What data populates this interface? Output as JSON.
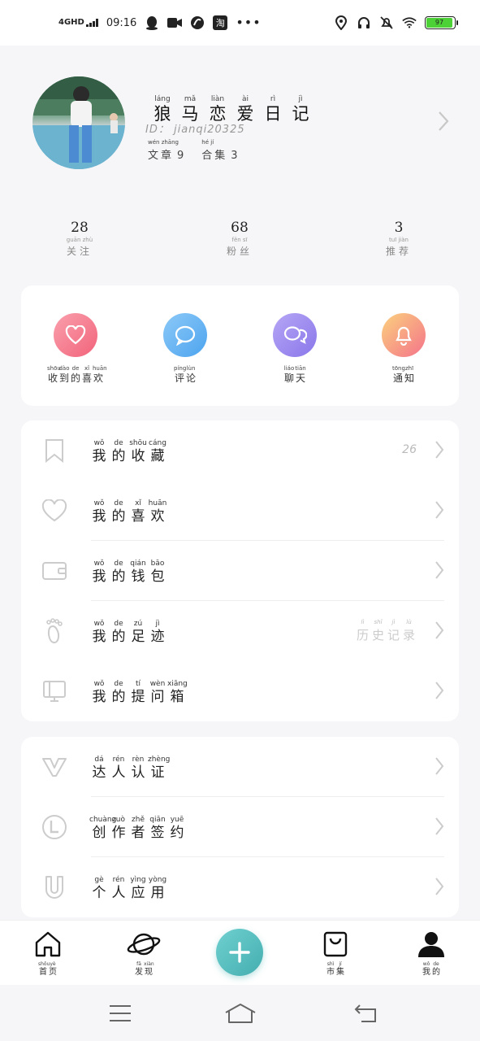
{
  "status_bar": {
    "network": "4GHD",
    "time": "09:16",
    "tao_icon_text": "淘",
    "more": "•••",
    "battery_level": "97"
  },
  "profile": {
    "name": [
      {
        "py": "láng",
        "hz": "狼"
      },
      {
        "py": "mǎ",
        "hz": "马"
      },
      {
        "py": "liàn",
        "hz": "恋"
      },
      {
        "py": "ài",
        "hz": "爱"
      },
      {
        "py": "rì",
        "hz": "日"
      },
      {
        "py": "jì",
        "hz": "记"
      }
    ],
    "id": "ID： jianqi20325",
    "articles": {
      "py": "wén zhāng",
      "hz": "文章",
      "count": "9"
    },
    "collections": {
      "py": "hé jí",
      "hz": "合集",
      "count": "3"
    }
  },
  "stats": [
    {
      "value": "28",
      "py": "guān zhù",
      "hz": "关注"
    },
    {
      "value": "68",
      "py": "fěn sī",
      "hz": "粉丝"
    },
    {
      "value": "3",
      "py": "tuī jiàn",
      "hz": "推荐"
    }
  ],
  "actions": [
    {
      "icon": "heart-icon",
      "color1": "#f9a0ad",
      "color2": "#f2637a",
      "label": [
        {
          "py": "shōu",
          "hz": "收"
        },
        {
          "py": "dào",
          "hz": "到"
        },
        {
          "py": "de",
          "hz": "的"
        },
        {
          "py": "xǐ",
          "hz": "喜"
        },
        {
          "py": "huān",
          "hz": "欢"
        }
      ]
    },
    {
      "icon": "comment-icon",
      "color1": "#8cc9f8",
      "color2": "#4da4ef",
      "label": [
        {
          "py": "píng",
          "hz": "评"
        },
        {
          "py": "lùn",
          "hz": "论"
        }
      ]
    },
    {
      "icon": "chat-icon",
      "color1": "#b6a6f5",
      "color2": "#8a77ea",
      "label": [
        {
          "py": "liáo",
          "hz": "聊"
        },
        {
          "py": "tiān",
          "hz": "天"
        }
      ]
    },
    {
      "icon": "bell-icon",
      "color1": "#fbd17e",
      "color2": "#f4738a",
      "label": [
        {
          "py": "tōng",
          "hz": "通"
        },
        {
          "py": "zhī",
          "hz": "知"
        }
      ]
    }
  ],
  "menu1": [
    {
      "name": "my-favorites",
      "icon": "bookmark-icon",
      "label": [
        {
          "py": "wǒ",
          "hz": "我"
        },
        {
          "py": "de",
          "hz": "的"
        },
        {
          "py": "shōu",
          "hz": "收"
        },
        {
          "py": "cáng",
          "hz": "藏"
        }
      ],
      "value": "26"
    },
    {
      "name": "my-likes",
      "icon": "heart-outline-icon",
      "label": [
        {
          "py": "wǒ",
          "hz": "我"
        },
        {
          "py": "de",
          "hz": "的"
        },
        {
          "py": "xǐ",
          "hz": "喜"
        },
        {
          "py": "huān",
          "hz": "欢"
        }
      ]
    },
    {
      "name": "my-wallet",
      "icon": "wallet-icon",
      "label": [
        {
          "py": "wǒ",
          "hz": "我"
        },
        {
          "py": "de",
          "hz": "的"
        },
        {
          "py": "qián",
          "hz": "钱"
        },
        {
          "py": "bāo",
          "hz": "包"
        }
      ]
    },
    {
      "name": "my-footprints",
      "icon": "footprint-icon",
      "label": [
        {
          "py": "wǒ",
          "hz": "我"
        },
        {
          "py": "de",
          "hz": "的"
        },
        {
          "py": "zú",
          "hz": "足"
        },
        {
          "py": "jì",
          "hz": "迹"
        }
      ],
      "value_py": [
        {
          "py": "lì",
          "hz": "历"
        },
        {
          "py": "shǐ",
          "hz": "史"
        },
        {
          "py": "jì",
          "hz": "记"
        },
        {
          "py": "lù",
          "hz": "录"
        }
      ]
    },
    {
      "name": "my-question-box",
      "icon": "question-box-icon",
      "label": [
        {
          "py": "wǒ",
          "hz": "我"
        },
        {
          "py": "de",
          "hz": "的"
        },
        {
          "py": "tí",
          "hz": "提"
        },
        {
          "py": "wèn",
          "hz": "问"
        },
        {
          "py": "xiāng",
          "hz": "箱"
        }
      ]
    }
  ],
  "menu2": [
    {
      "name": "expert-verification",
      "icon": "v-icon",
      "label": [
        {
          "py": "dá",
          "hz": "达"
        },
        {
          "py": "rén",
          "hz": "人"
        },
        {
          "py": "rèn",
          "hz": "认"
        },
        {
          "py": "zhèng",
          "hz": "证"
        }
      ]
    },
    {
      "name": "creator-contract",
      "icon": "l-circle-icon",
      "label": [
        {
          "py": "chuàng",
          "hz": "创"
        },
        {
          "py": "zuò",
          "hz": "作"
        },
        {
          "py": "zhě",
          "hz": "者"
        },
        {
          "py": "qiān",
          "hz": "签"
        },
        {
          "py": "yuē",
          "hz": "约"
        }
      ]
    },
    {
      "name": "personal-apps",
      "icon": "u-icon",
      "label": [
        {
          "py": "gè",
          "hz": "个"
        },
        {
          "py": "rén",
          "hz": "人"
        },
        {
          "py": "yìng",
          "hz": "应"
        },
        {
          "py": "yòng",
          "hz": "用"
        }
      ]
    }
  ],
  "bottom_nav": [
    {
      "name": "home",
      "icon": "home-icon",
      "label": [
        {
          "py": "shǒu",
          "hz": "首"
        },
        {
          "py": "yè",
          "hz": "页"
        }
      ]
    },
    {
      "name": "discover",
      "icon": "planet-icon",
      "label": [
        {
          "py": "fā",
          "hz": "发"
        },
        {
          "py": "xiàn",
          "hz": "现"
        }
      ]
    },
    {
      "name": "market",
      "icon": "shopping-bag-icon",
      "label": [
        {
          "py": "shì",
          "hz": "市"
        },
        {
          "py": "jí",
          "hz": "集"
        }
      ]
    },
    {
      "name": "me",
      "icon": "person-icon",
      "label": [
        {
          "py": "wǒ",
          "hz": "我"
        },
        {
          "py": "de",
          "hz": "的"
        }
      ]
    }
  ],
  "colors": {
    "accent": "#45aeb0",
    "card": "#ffffff",
    "background": "#f6f6f8"
  }
}
